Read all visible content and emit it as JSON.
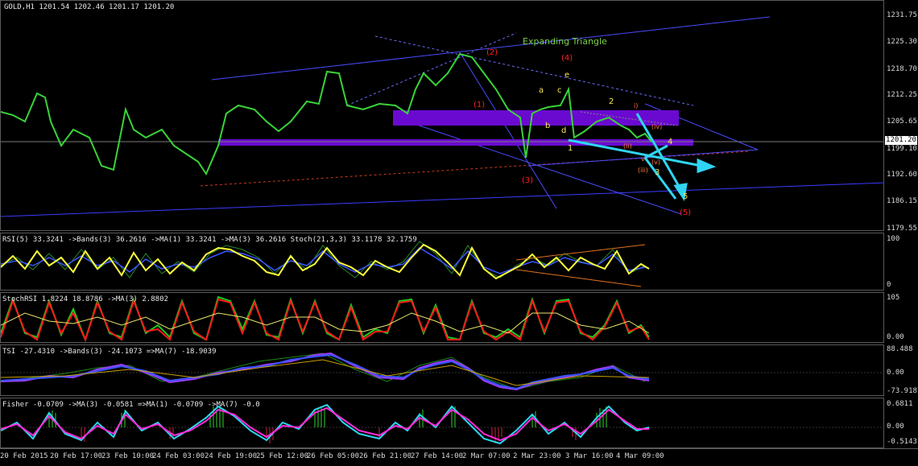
{
  "main": {
    "title": "GOLD,H1  1201.54 1202.46 1201.17 1201.20",
    "price_scale": [
      "1231.75",
      "1225.30",
      "1218.70",
      "1212.25",
      "1205.65",
      "1199.10",
      "1192.60",
      "1186.15",
      "1179.55"
    ],
    "current_price": "1201.20",
    "annotation": "Expanding Triangle",
    "wave_labels_red": [
      "(2)",
      "(4)",
      "(1)",
      "(3)",
      "(5)"
    ],
    "wave_labels_yellow": [
      "a",
      "c",
      "e",
      "b",
      "d",
      "2",
      "1",
      "4",
      "3",
      "5"
    ],
    "wave_labels_small": [
      "i)",
      "(iv)",
      "(ii)",
      "(v)",
      "(iii)",
      "v"
    ]
  },
  "rsi": {
    "title": "RSI(5) 33.3241  ->Bands(3) 36.2616  ->MA(1) 33.3241  ->MA(3) 36.2616  Stoch(21,3,3) 33.1178  32.1759",
    "scale": [
      "100",
      "0"
    ]
  },
  "stochrsi": {
    "title": "StochRSI 1.8224 18.8786  ->MA(3) 2.8802",
    "scale": [
      "105",
      "0.00"
    ]
  },
  "tsi": {
    "title": "TSI -27.4310  ->Bands(3) -24.1073  =>MA(7) -18.9039",
    "scale": [
      "88.488",
      "0.00",
      "-73.9187"
    ]
  },
  "fisher": {
    "title": "Fisher -0.0709  ->MA(3) -0.0581  =>MA(1) -0.0709  ->MA(7) -0.0",
    "scale": [
      "0.6811",
      "0.00",
      "-0.5143"
    ]
  },
  "time_axis": [
    "20 Feb 2015",
    "20 Feb 17:00",
    "23 Feb 10:00",
    "24 Feb 03:00",
    "24 Feb 19:00",
    "25 Feb 12:00",
    "26 Feb 05:00",
    "26 Feb 21:00",
    "27 Feb 14:00",
    "2 Mar 07:00",
    "2 Mar 23:00",
    "3 Mar 16:00",
    "4 Mar 09:00"
  ]
}
